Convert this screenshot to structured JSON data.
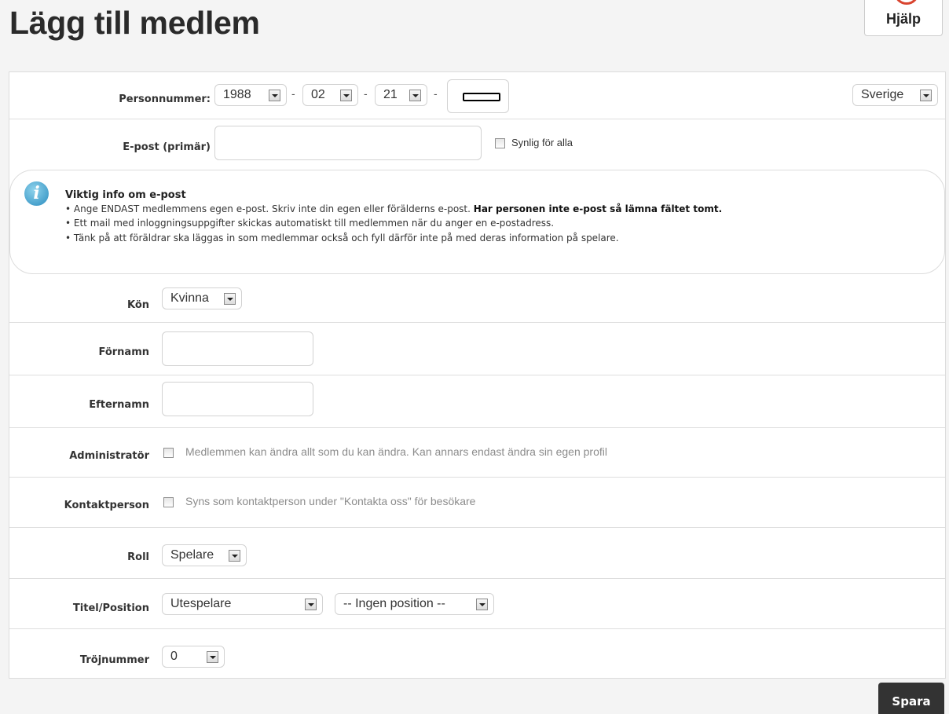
{
  "page": {
    "title": "Lägg till medlem",
    "help_label": "Hjälp"
  },
  "personnummer": {
    "label": "Personnummer:",
    "year": "1988",
    "month": "02",
    "day": "21",
    "separator": "-",
    "country": "Sverige"
  },
  "email": {
    "label": "E-post (primär)",
    "visible_label": "Synlig för alla"
  },
  "info": {
    "title": "Viktig info om e-post",
    "bullet1_text": "• Ange ENDAST medlemmens egen e-post. Skriv inte din egen eller förälderns e-post. ",
    "bullet1_bold": "Har personen inte e-post så lämna fältet tomt.",
    "bullet2": "• Ett mail med inloggningsuppgifter skickas automatiskt till medlemmen när du anger en e-postadress.",
    "bullet3": "• Tänk på att föräldrar ska läggas in som medlemmar också och fyll därför inte på med deras information på spelare."
  },
  "gender": {
    "label": "Kön",
    "value": "Kvinna"
  },
  "firstname": {
    "label": "Förnamn"
  },
  "lastname": {
    "label": "Efternamn"
  },
  "admin": {
    "label": "Administratör",
    "text": "Medlemmen kan ändra allt som du kan ändra. Kan annars endast ändra sin egen profil"
  },
  "contact": {
    "label": "Kontaktperson",
    "text": "Syns som kontaktperson under \"Kontakta oss\" för besökare"
  },
  "role": {
    "label": "Roll",
    "value": "Spelare"
  },
  "position": {
    "label": "Titel/Position",
    "title_value": "Utespelare",
    "position_value": "-- Ingen position --"
  },
  "jersey": {
    "label": "Tröjnummer",
    "value": "0"
  },
  "save_label": "Spara"
}
